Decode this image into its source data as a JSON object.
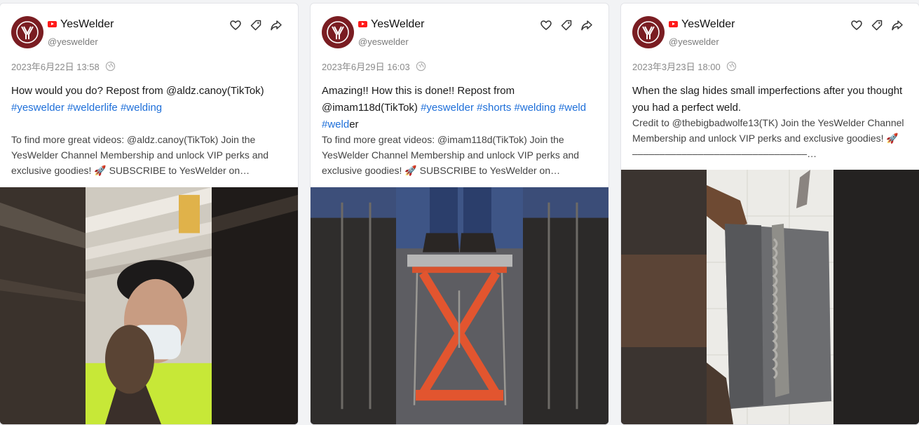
{
  "posts": [
    {
      "channel": "YesWelder",
      "handle": "@yeswelder",
      "date": "2023年6月22日 13:58",
      "title_parts": [
        {
          "text": "How would you do? Repost from @aldz.canoy(TikTok) ",
          "tag": false
        },
        {
          "text": "#yeswelder",
          "tag": true
        },
        {
          "text": " ",
          "tag": false
        },
        {
          "text": "#welderlife",
          "tag": true
        },
        {
          "text": " ",
          "tag": false
        },
        {
          "text": "#welding",
          "tag": true
        }
      ],
      "description": "To find more great videos: @aldz.canoy(TikTok) Join the YesWelder Channel Membership and unlock VIP perks and exclusive goodies! 🚀 SUBSCRIBE to YesWelder on…",
      "media_label": "welder-selfie-video-thumbnail"
    },
    {
      "channel": "YesWelder",
      "handle": "@yeswelder",
      "date": "2023年6月29日 16:03",
      "title_parts": [
        {
          "text": "Amazing!! How this is done!! Repost from @imam118d(TikTok) ",
          "tag": false
        },
        {
          "text": "#yeswelder",
          "tag": true
        },
        {
          "text": " ",
          "tag": false
        },
        {
          "text": "#shorts",
          "tag": true
        },
        {
          "text": " ",
          "tag": false
        },
        {
          "text": "#welding",
          "tag": true
        },
        {
          "text": " ",
          "tag": false
        },
        {
          "text": "#weld",
          "tag": true
        },
        {
          "text": " ",
          "tag": false
        },
        {
          "text": "#weld",
          "tag": true
        },
        {
          "text": "er",
          "tag": false
        }
      ],
      "description": "To find more great videos: @imam118d(TikTok) Join the YesWelder Channel Membership and unlock VIP perks and exclusive goodies! 🚀 SUBSCRIBE to YesWelder on…",
      "media_label": "chain-stool-video-thumbnail"
    },
    {
      "channel": "YesWelder",
      "handle": "@yeswelder",
      "date": "2023年3月23日 18:00",
      "title_parts": [
        {
          "text": "When the slag hides small imperfections after you thought you had a perfect weld.",
          "tag": false
        }
      ],
      "description": "Credit to @thebigbadwolfe13(TK) Join the YesWelder Channel Membership and unlock VIP perks and exclusive goodies! 🚀 ––––––––––––––––––––––––––––––––…",
      "media_label": "weld-bead-video-thumbnail"
    }
  ],
  "colors": {
    "hashtag": "#1e6fd9",
    "avatar_bg": "#7a1d22",
    "youtube_red": "#ff1a1a"
  },
  "icons": [
    "heart-icon",
    "tag-icon",
    "share-icon",
    "globe-icon",
    "youtube-icon"
  ]
}
